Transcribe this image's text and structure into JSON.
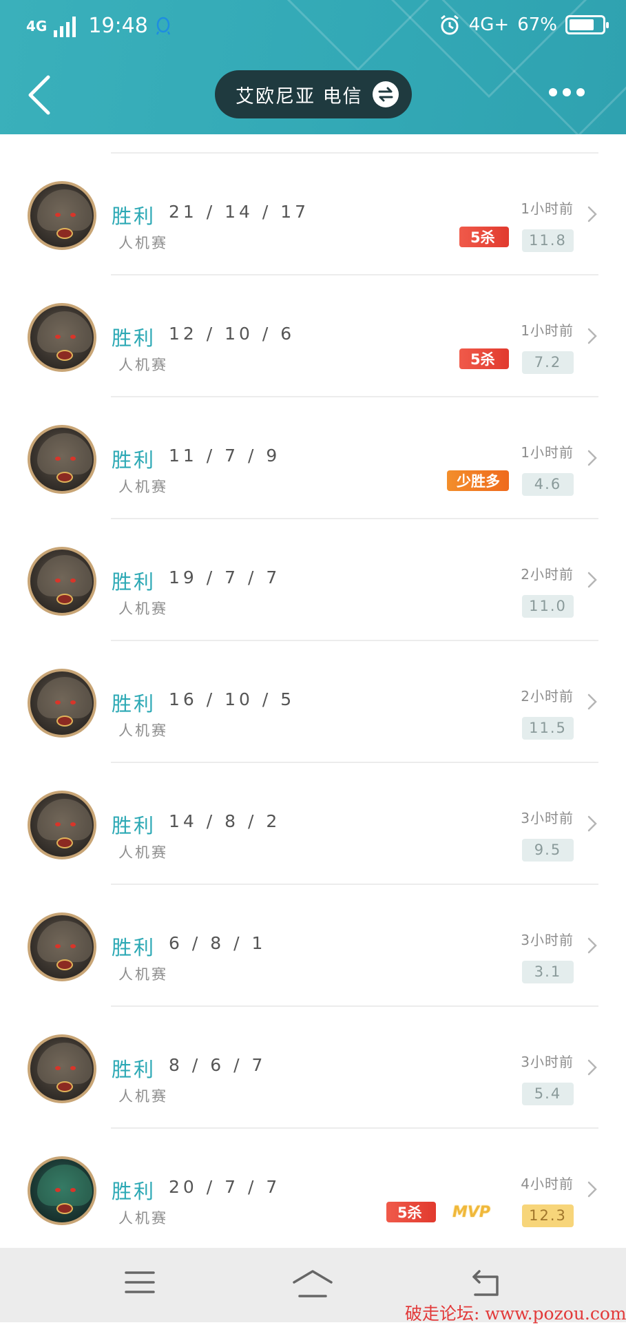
{
  "status_bar": {
    "network_left": "4G",
    "time": "19:48",
    "network_right": "4G+",
    "battery": "67%",
    "battery_level": 0.67
  },
  "header": {
    "server_name": "艾欧尼亚  电信"
  },
  "matches": [
    {
      "result": "胜利",
      "kda": "21 / 14 / 17",
      "mode": "人机赛",
      "time": "1小时前",
      "score": "11.8",
      "badges": [
        "5杀"
      ],
      "gold": false,
      "avatar": "dark"
    },
    {
      "result": "胜利",
      "kda": "12 / 10 / 6",
      "mode": "人机赛",
      "time": "1小时前",
      "score": "7.2",
      "badges": [
        "5杀"
      ],
      "gold": false,
      "avatar": "dark"
    },
    {
      "result": "胜利",
      "kda": "11 / 7 / 9",
      "mode": "人机赛",
      "time": "1小时前",
      "score": "4.6",
      "badges": [
        "少胜多"
      ],
      "gold": false,
      "avatar": "dark"
    },
    {
      "result": "胜利",
      "kda": "19 / 7 / 7",
      "mode": "人机赛",
      "time": "2小时前",
      "score": "11.0",
      "badges": [],
      "gold": false,
      "avatar": "dark"
    },
    {
      "result": "胜利",
      "kda": "16 / 10 / 5",
      "mode": "人机赛",
      "time": "2小时前",
      "score": "11.5",
      "badges": [],
      "gold": false,
      "avatar": "dark"
    },
    {
      "result": "胜利",
      "kda": "14 / 8 / 2",
      "mode": "人机赛",
      "time": "3小时前",
      "score": "9.5",
      "badges": [],
      "gold": false,
      "avatar": "dark"
    },
    {
      "result": "胜利",
      "kda": "6 / 8 / 1",
      "mode": "人机赛",
      "time": "3小时前",
      "score": "3.1",
      "badges": [],
      "gold": false,
      "avatar": "dark"
    },
    {
      "result": "胜利",
      "kda": "8 / 6 / 7",
      "mode": "人机赛",
      "time": "3小时前",
      "score": "5.4",
      "badges": [],
      "gold": false,
      "avatar": "dark"
    },
    {
      "result": "胜利",
      "kda": "20 / 7 / 7",
      "mode": "人机赛",
      "time": "4小时前",
      "score": "12.3",
      "badges": [
        "5杀",
        "MVP"
      ],
      "gold": true,
      "avatar": "green"
    }
  ],
  "watermark": "破走论坛: www.pozou.com",
  "colors": {
    "header": "#33a9b6",
    "accent": "#2ba8b4",
    "pill": "#1f3a3f",
    "kill_badge": "#e13a2e",
    "gold_score": "#f7d57a"
  }
}
